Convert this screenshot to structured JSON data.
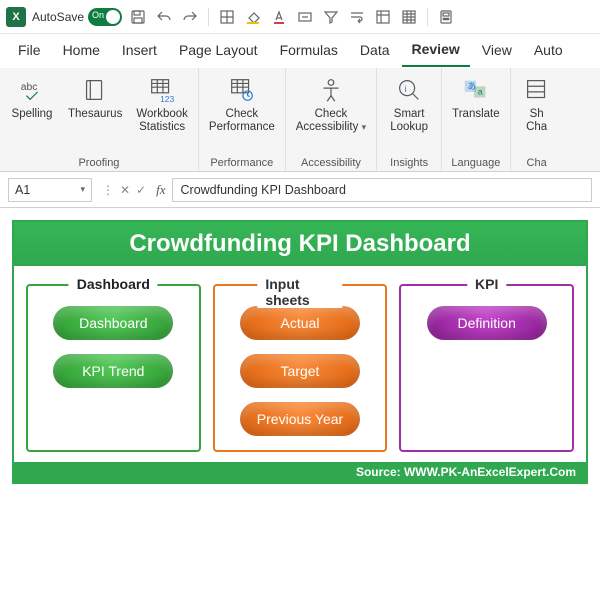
{
  "titlebar": {
    "autosave_label": "AutoSave",
    "toggle_state": "On"
  },
  "tabs": {
    "file": "File",
    "home": "Home",
    "insert": "Insert",
    "pagelayout": "Page Layout",
    "formulas": "Formulas",
    "data": "Data",
    "review": "Review",
    "view": "View",
    "automate": "Auto"
  },
  "ribbon": {
    "spelling": "Spelling",
    "thesaurus": "Thesaurus",
    "workbook_stats_l1": "Workbook",
    "workbook_stats_l2": "Statistics",
    "proofing_group": "Proofing",
    "check_perf_l1": "Check",
    "check_perf_l2": "Performance",
    "performance_group": "Performance",
    "check_acc_l1": "Check",
    "check_acc_l2": "Accessibility",
    "accessibility_group": "Accessibility",
    "smart_l1": "Smart",
    "smart_l2": "Lookup",
    "insights_group": "Insights",
    "translate": "Translate",
    "language_group": "Language",
    "show_changes_l1": "Sh",
    "show_changes_l2": "Cha",
    "changes_group": "Cha"
  },
  "formula_bar": {
    "cell_ref": "A1",
    "formula_value": "Crowdfunding KPI Dashboard"
  },
  "dashboard": {
    "title": "Crowdfunding KPI Dashboard",
    "card1_title": "Dashboard",
    "card1_btn1": "Dashboard",
    "card1_btn2": "KPI Trend",
    "card2_title": "Input sheets",
    "card2_btn1": "Actual",
    "card2_btn2": "Target",
    "card2_btn3": "Previous Year",
    "card3_title": "KPI",
    "card3_btn1": "Definition",
    "footer": "Source: WWW.PK-AnExcelExpert.Com"
  }
}
